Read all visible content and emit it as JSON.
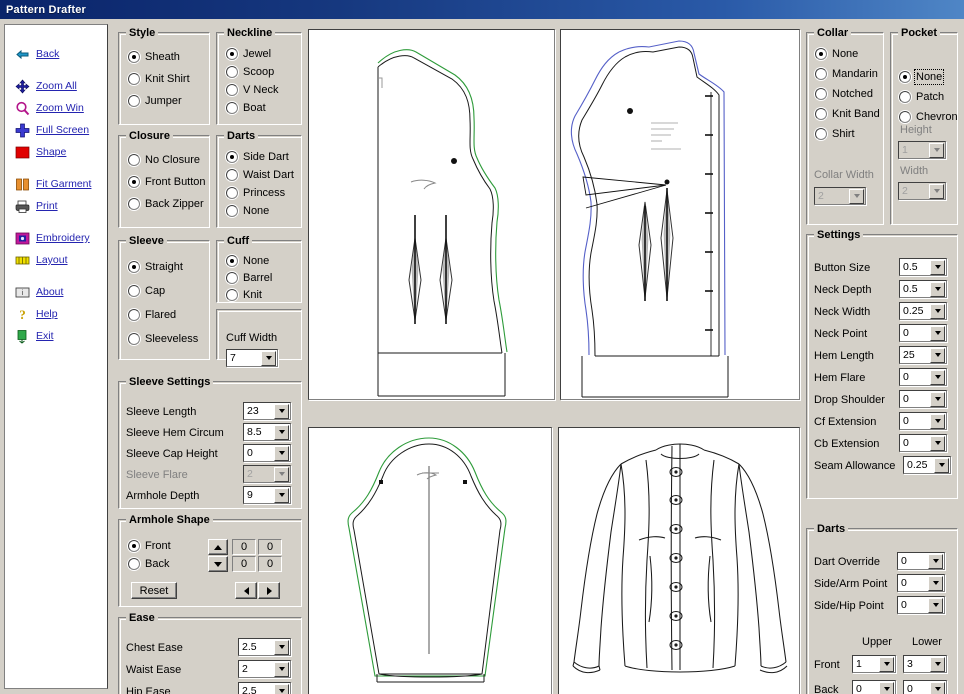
{
  "window": {
    "title": "Pattern Drafter"
  },
  "sidebar": {
    "items": [
      {
        "label": "Back",
        "icon": "back-arrow-icon"
      },
      {
        "label": "Zoom All",
        "icon": "zoom-all-icon"
      },
      {
        "label": "Zoom Win",
        "icon": "magnifier-icon"
      },
      {
        "label": "Full Screen",
        "icon": "full-screen-icon"
      },
      {
        "label": "Shape",
        "icon": "red-square-icon"
      },
      {
        "label": "Fit Garment",
        "icon": "fit-garment-icon"
      },
      {
        "label": "Print",
        "icon": "printer-icon"
      },
      {
        "label": "Embroidery",
        "icon": "embroidery-icon"
      },
      {
        "label": "Layout",
        "icon": "layout-icon"
      },
      {
        "label": "About",
        "icon": "about-icon"
      },
      {
        "label": "Help",
        "icon": "help-key-icon"
      },
      {
        "label": "Exit",
        "icon": "exit-door-icon"
      }
    ]
  },
  "style_group": {
    "title": "Style",
    "options": [
      "Sheath",
      "Knit Shirt",
      "Jumper"
    ],
    "selected": "Sheath"
  },
  "neckline_group": {
    "title": "Neckline",
    "options": [
      "Jewel",
      "Scoop",
      "V Neck",
      "Boat"
    ],
    "selected": "Jewel"
  },
  "closure_group": {
    "title": "Closure",
    "options": [
      "No Closure",
      "Front Button",
      "Back Zipper"
    ],
    "selected": "Front Button"
  },
  "darts_group": {
    "title": "Darts",
    "options": [
      "Side Dart",
      "Waist Dart",
      "Princess",
      "None"
    ],
    "selected": "Side Dart"
  },
  "sleeve_group": {
    "title": "Sleeve",
    "options": [
      "Straight",
      "Cap",
      "Flared",
      "Sleeveless"
    ],
    "selected": "Straight"
  },
  "cuff_group": {
    "title": "Cuff",
    "options": [
      "None",
      "Barrel",
      "Knit"
    ],
    "selected": "None",
    "width_label": "Cuff Width",
    "width_value": "7"
  },
  "sleeve_settings": {
    "title": "Sleeve Settings",
    "rows": [
      {
        "label": "Sleeve Length",
        "value": "23",
        "disabled": false
      },
      {
        "label": "Sleeve Hem Circum",
        "value": "8.5",
        "disabled": false
      },
      {
        "label": "Sleeve Cap Height",
        "value": "0",
        "disabled": false
      },
      {
        "label": "Sleeve Flare",
        "value": "2",
        "disabled": true
      },
      {
        "label": "Armhole Depth",
        "value": "9",
        "disabled": false
      }
    ]
  },
  "armhole_shape": {
    "title": "Armhole Shape",
    "options": [
      "Front",
      "Back"
    ],
    "selected": "Front",
    "reset_label": "Reset",
    "cells": [
      "0",
      "0",
      "0",
      "0"
    ]
  },
  "ease_group": {
    "title": "Ease",
    "rows": [
      {
        "label": "Chest Ease",
        "value": "2.5"
      },
      {
        "label": "Waist Ease",
        "value": "2"
      },
      {
        "label": "Hip Ease",
        "value": "2.5"
      }
    ]
  },
  "collar_group": {
    "title": "Collar",
    "options": [
      "None",
      "Mandarin",
      "Notched",
      "Knit Band",
      "Shirt"
    ],
    "selected": "None",
    "width_label": "Collar Width",
    "width_value": "2",
    "width_disabled": true
  },
  "pocket_group": {
    "title": "Pocket",
    "options": [
      "None",
      "Patch",
      "Chevron"
    ],
    "selected": "None",
    "height_label": "Height",
    "height_value": "1",
    "width_label": "Width",
    "width_value": "2",
    "disabled": true
  },
  "settings_group": {
    "title": "Settings",
    "rows": [
      {
        "label": "Button Size",
        "value": "0.5"
      },
      {
        "label": "Neck Depth",
        "value": "0.5"
      },
      {
        "label": "Neck Width",
        "value": "0.25"
      },
      {
        "label": "Neck Point",
        "value": "0"
      },
      {
        "label": "Hem Length",
        "value": "25"
      },
      {
        "label": "Hem Flare",
        "value": "0"
      },
      {
        "label": "Drop Shoulder",
        "value": "0"
      },
      {
        "label": "Cf Extension",
        "value": "0"
      },
      {
        "label": "Cb Extension",
        "value": "0"
      },
      {
        "label": "Seam Allowance",
        "value": "0.25"
      }
    ]
  },
  "darts_settings": {
    "title": "Darts",
    "rows": [
      {
        "label": "Dart Override",
        "value": "0"
      },
      {
        "label": "Side/Arm Point",
        "value": "0"
      },
      {
        "label": "Side/Hip Point",
        "value": "0"
      }
    ],
    "col_upper": "Upper",
    "col_lower": "Lower",
    "grid": [
      {
        "label": "Front",
        "upper": "1",
        "lower": "3"
      },
      {
        "label": "Back",
        "upper": "0",
        "lower": "0"
      }
    ]
  },
  "canvases": {
    "back_bodice": "back-bodice-pattern",
    "front_bodice": "front-bodice-pattern",
    "sleeve": "sleeve-pattern",
    "garment": "garment-flat-illustration"
  },
  "colors": {
    "titlebar_start": "#0a246a",
    "titlebar_end": "#4f86c6",
    "face": "#d4d0c8",
    "link": "#2424b0",
    "seam_green": "#2e9b3a",
    "seam_blue": "#5560c8",
    "outline": "#1a1a1a",
    "shape_red": "#e00000"
  }
}
